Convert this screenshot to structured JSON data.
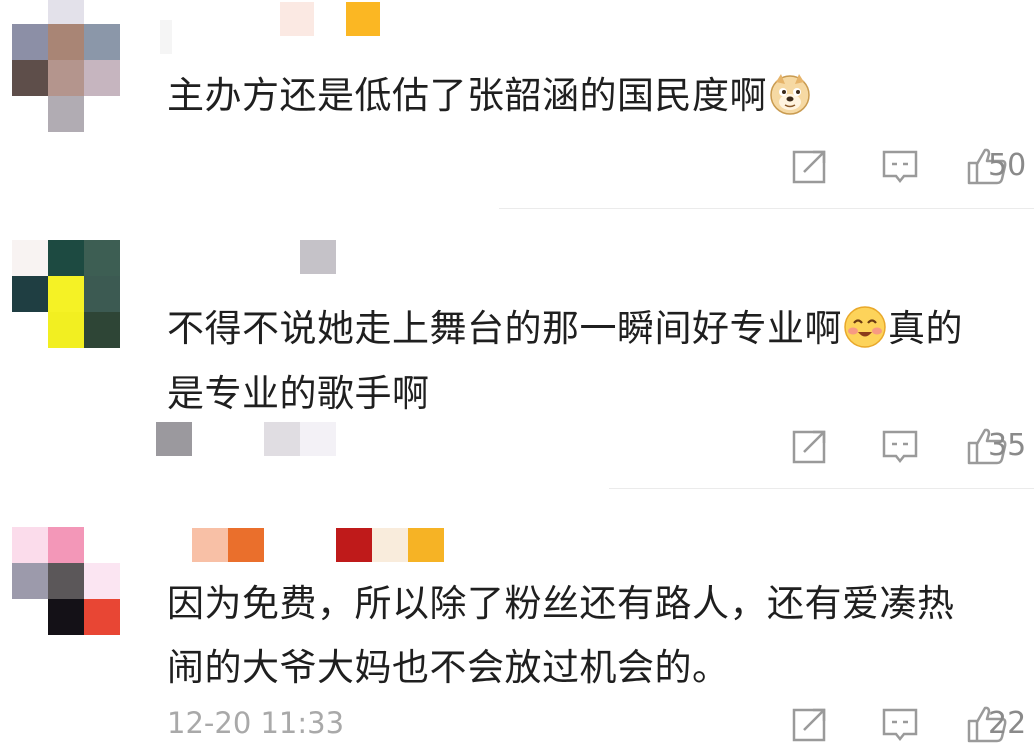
{
  "comments": [
    {
      "text": "主办方还是低估了张韶涵的国民度啊",
      "emoji": "doge-emoji",
      "likes": "50",
      "avatar_colors": [
        "#e3e1ea",
        "#8c8fa6",
        "#a98575",
        "#8b97a9",
        "#5e4e4a",
        "#b4958d",
        "#c6b5bf",
        "#b1acb3"
      ],
      "name_mosaic_colors": [
        "#f5f5f5",
        "#fbe9e3",
        "#fbb723"
      ]
    },
    {
      "text_line1": "不得不说她走上舞台的那一瞬间好专业啊",
      "emoji": "blush-smile-emoji",
      "text_line1_tail": "真的",
      "text_line2": "是专业的歌手啊",
      "likes": "35",
      "avatar_colors": [
        "#f8f3f2",
        "#1d4a41",
        "#3d5e53",
        "#1f3e42",
        "#f5f225",
        "#3c5a52",
        "#f2ef21",
        "#2e4536"
      ],
      "name_mosaic_colors": [
        "#c5c2c8",
        "#9b999e",
        "#e0dde2",
        "#f3f1f6"
      ]
    },
    {
      "text_line1": "因为免费，所以除了粉丝还有路人，还有爱凑热",
      "text_line2": "闹的大爷大妈也不会放过机会的。",
      "timestamp": "12-20 11:33",
      "likes": "22",
      "avatar_colors": [
        "#fbdceb",
        "#f397b8",
        "#9c9aab",
        "#5b5759",
        "#fbe5f2",
        "#141117",
        "#e84634"
      ],
      "name_mosaic_colors": [
        "#f8c0a6",
        "#ea6f2c",
        "#bf1a1a",
        "#f9ecdc",
        "#f6b325"
      ]
    }
  ],
  "icons": [
    "share-icon",
    "comment-icon",
    "like-icon"
  ]
}
